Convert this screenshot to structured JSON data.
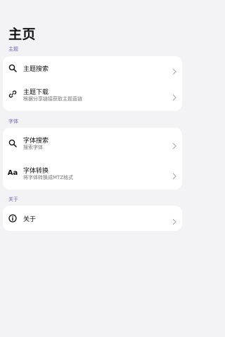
{
  "header": {
    "title": "主页"
  },
  "sections": [
    {
      "title": "主题",
      "items": [
        {
          "title": "主题搜索",
          "icon": "search-icon"
        },
        {
          "title": "主题下载",
          "subtitle": "根据分享链接获取主题直链",
          "icon": "link-icon"
        }
      ]
    },
    {
      "title": "字体",
      "items": [
        {
          "title": "字体搜索",
          "subtitle": "搜索字体",
          "icon": "search-icon"
        },
        {
          "title": "字体转换",
          "subtitle": "将字体转换成MTZ格式",
          "icon": "font-aa-icon",
          "glyph": "Aa"
        }
      ]
    },
    {
      "title": "关于",
      "items": [
        {
          "title": "关于",
          "icon": "info-icon"
        }
      ]
    }
  ]
}
